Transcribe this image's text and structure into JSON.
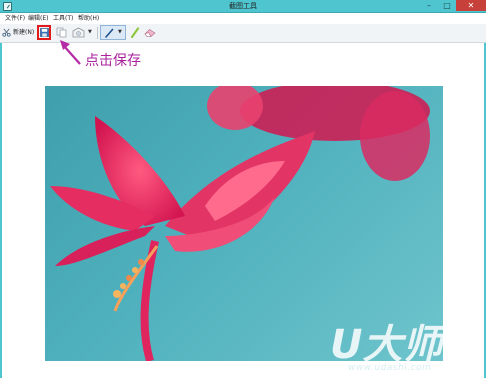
{
  "window": {
    "title": "截图工具",
    "close_glyph": "✕",
    "max_glyph": "□",
    "min_glyph": "–"
  },
  "menu": {
    "file": "文件(F)",
    "edit": "编辑(E)",
    "tools": "工具(T)",
    "help": "帮助(H)"
  },
  "toolbar": {
    "new_label": "新建(N)",
    "items": [
      "scissors-icon",
      "save-icon",
      "copy-icon",
      "send-icon",
      "pen-icon",
      "highlighter-icon",
      "eraser-icon"
    ]
  },
  "annotation": {
    "text": "点击保存",
    "color": "#a9219d",
    "highlight_color": "#e21a1a"
  },
  "watermark": {
    "logo_text": "U大师",
    "url": "www.udashi.com"
  },
  "colors": {
    "titlebar": "#4fc6cf",
    "close": "#c7403a",
    "flower": "#e0245e",
    "background": "#4fb1bd"
  }
}
